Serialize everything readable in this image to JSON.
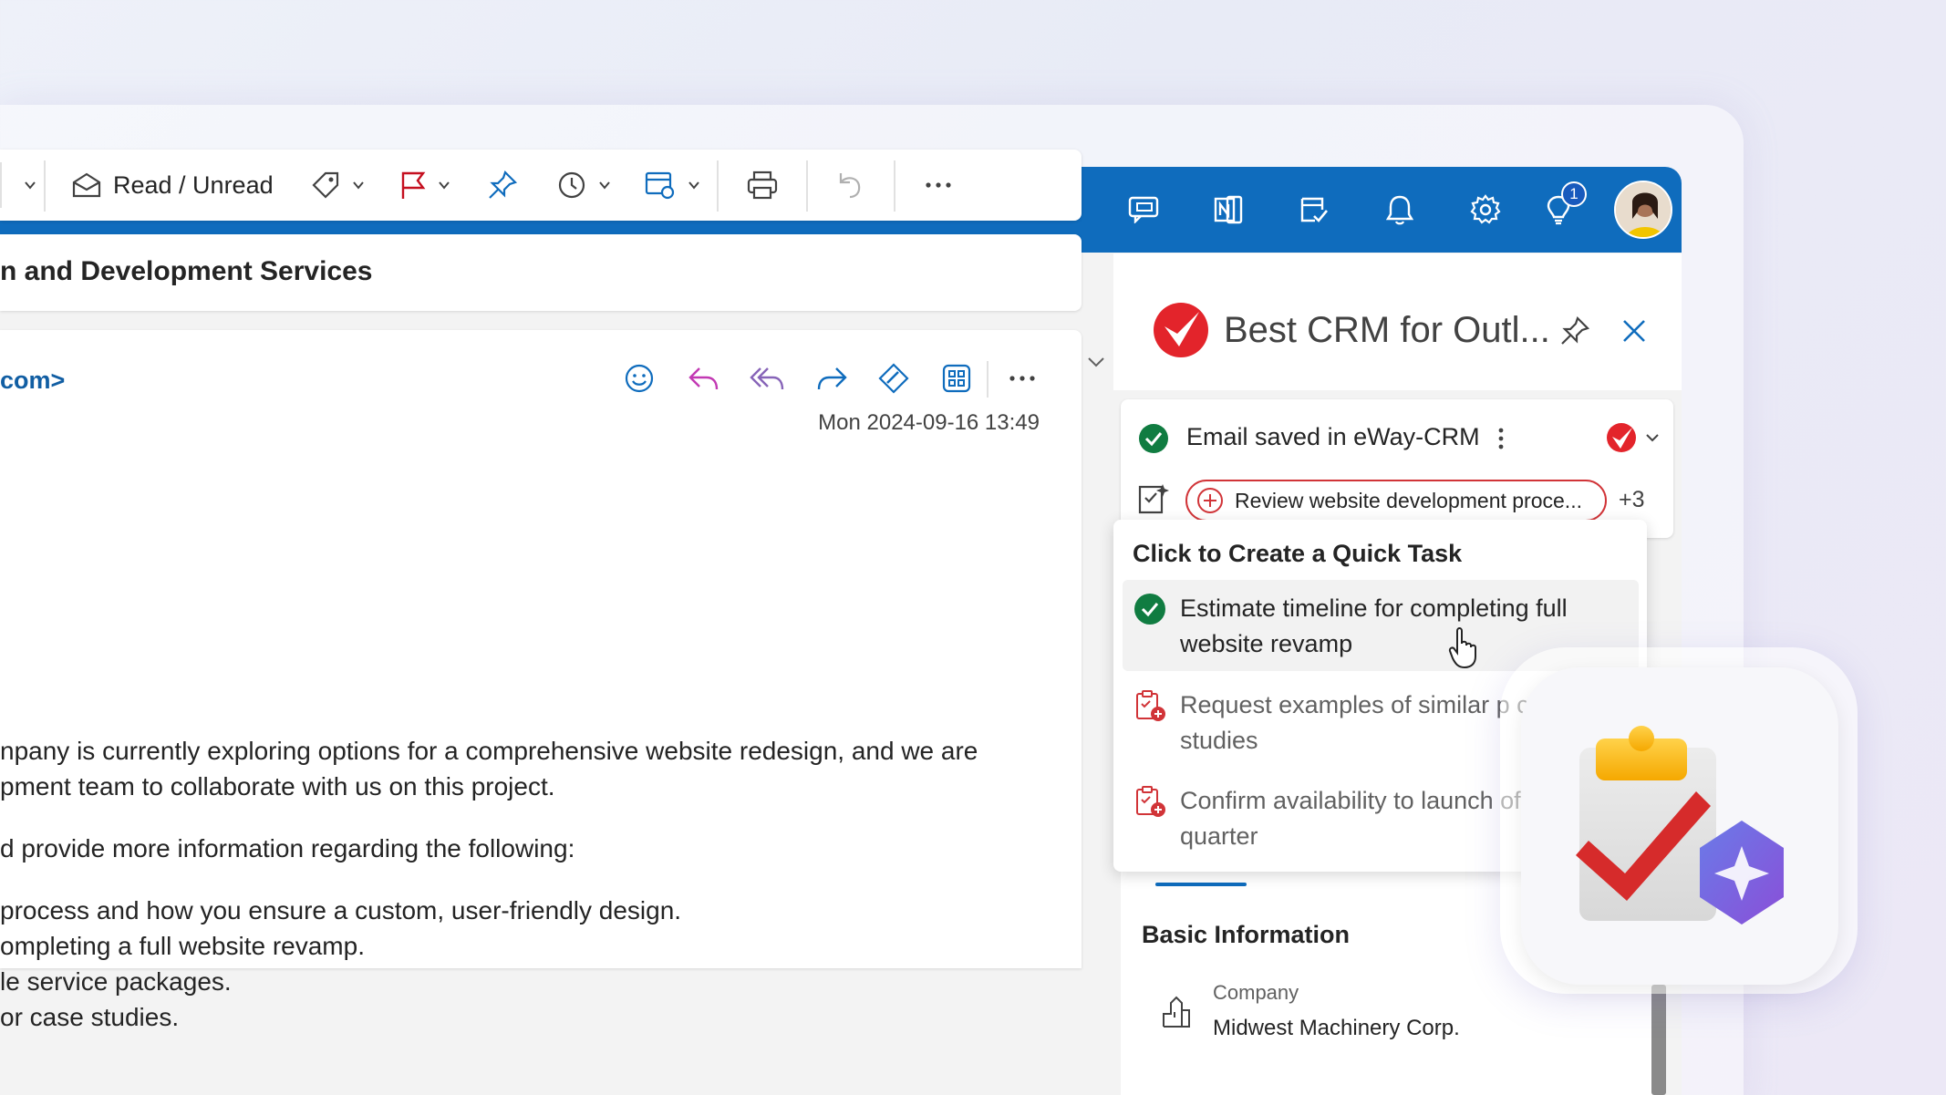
{
  "toolbar": {
    "read_unread_label": "Read / Unread"
  },
  "email": {
    "subject": "n and Development Services",
    "sender": "com>",
    "date": "Mon 2024-09-16 13:49",
    "body": [
      "npany is currently exploring options for a comprehensive website redesign, and we are",
      "pment team to collaborate with us on this project.",
      "d provide more information regarding the following:",
      "process and how you ensure a custom, user-friendly design.",
      "ompleting a full website revamp.",
      "le service packages.",
      "or case studies."
    ]
  },
  "topbar": {
    "notification_count": "1"
  },
  "addin": {
    "title": "Best CRM for Outl...",
    "saved_status": "Email saved in eWay-CRM",
    "task_pill": "Review website development proce...",
    "more_count": "+3",
    "dropdown_title": "Click to Create a Quick Task",
    "tasks": [
      "Estimate timeline for completing full website revamp",
      "Request examples of similar p case studies",
      "Confirm availability to launch of this quarter"
    ],
    "section_title": "Basic Information",
    "company_label": "Company",
    "company_value": "Midwest Machinery Corp."
  },
  "colors": {
    "brand_blue": "#0f6cbd",
    "accent_red": "#d13438",
    "success_green": "#107c41"
  }
}
